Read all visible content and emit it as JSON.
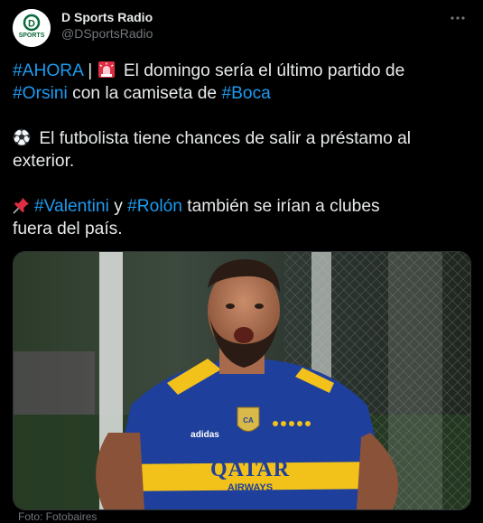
{
  "author": {
    "display_name": "D Sports Radio",
    "handle": "@DSportsRadio",
    "avatar_logo_text": "SPORTS",
    "avatar_logo_letter": "D"
  },
  "more_icon": "ellipsis-icon",
  "tweet": {
    "line1": {
      "tag1": "#AHORA",
      "sep": " | ",
      "emoji1": "rotating-light-emoji",
      "text1": " El domingo sería el último partido de"
    },
    "line2": {
      "tag2": "#Orsini",
      "text2": " con la camiseta de ",
      "tag3": "#Boca"
    },
    "line3": {
      "emoji2": "soccer-ball-emoji",
      "text3": " El futbolista tiene chances de salir a préstamo al"
    },
    "line4": {
      "text4": "exterior."
    },
    "line5": {
      "emoji3": "pushpin-emoji",
      "tag4": "#Valentini",
      "text5": " y ",
      "tag5": "#Rolón",
      "text6": " también se irían a clubes"
    },
    "line6": {
      "text7": "fuera del país."
    }
  },
  "media": {
    "jersey_sponsor": "QATAR",
    "jersey_sponsor_sub": "AIRWAYS",
    "jersey_brand": "adidas"
  },
  "credit": "Foto: Fotobaires"
}
